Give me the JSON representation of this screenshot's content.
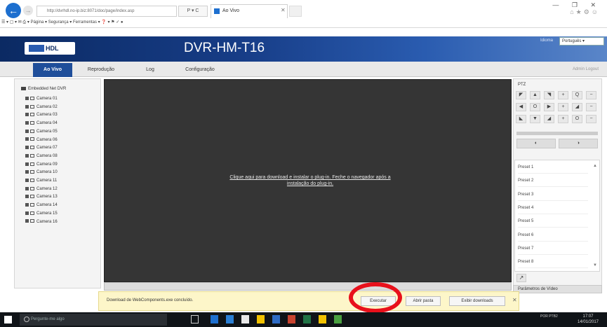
{
  "browser": {
    "address": "http://dvrhdl.no-ip.biz:8071/doc/page/index.asp",
    "address_ctrl": "P ▾ C",
    "tab_title": "Ao Vivo",
    "command_bar": "Página ▾  Segurança ▾  Ferramentas ▾",
    "window_controls": "— ❐ ✕"
  },
  "app": {
    "logo_text": "HDL",
    "title": "DVR-HM-T16",
    "language_label": "Idioma",
    "language_value": "Português ▾"
  },
  "nav": {
    "items": [
      {
        "label": "Ao Vivo"
      },
      {
        "label": "Reprodução"
      },
      {
        "label": "Log"
      },
      {
        "label": "Configuração"
      }
    ],
    "right": "Admin  Logout"
  },
  "tree": {
    "root": "Embedded Net DVR",
    "cameras": [
      "Camera 01",
      "Camera 02",
      "Camera 03",
      "Camera 04",
      "Camera 05",
      "Camera 06",
      "Camera 07",
      "Camera 08",
      "Camera 09",
      "Camera 10",
      "Camera 11",
      "Camera 12",
      "Camera 13",
      "Camera 14",
      "Camera 15",
      "Camera 16"
    ]
  },
  "video": {
    "plugin_message_line1": "Clique aqui para download e instalar o plug-in. Feche o navegador após a",
    "plugin_message_line2": "instalação do plug-in."
  },
  "ptz": {
    "title": "PTZ",
    "buttons": [
      "◤",
      "▲",
      "◥",
      "+",
      "Q",
      "−",
      "◀",
      "O",
      "▶",
      "+",
      "◢",
      "−",
      "◣",
      "▼",
      "◢",
      "+",
      "O",
      "−"
    ],
    "big_left": "◐",
    "big_right": "◑",
    "presets": [
      "Preset 1",
      "Preset 2",
      "Preset 3",
      "Preset 4",
      "Preset 5",
      "Preset 6",
      "Preset 7",
      "Preset 8"
    ],
    "preset_call": "↗",
    "video_params": "Parâmetros de Vídeo"
  },
  "notification": {
    "text": "Download de WebComponents.exe concluído.",
    "run": "Executar",
    "open_folder": "Abrir pasta",
    "view_downloads": "Exibir downloads",
    "close": "✕"
  },
  "taskbar": {
    "search": "Pergunte-me algo",
    "tray": "POR PTB2",
    "time": "17:07",
    "date": "14/01/2017"
  },
  "colors": {
    "header": "#173d87",
    "nav_active": "#1f4e9a",
    "video_bg": "#353535",
    "highlight_circle": "#e8101b",
    "notification_bg": "#fdf6c9"
  }
}
